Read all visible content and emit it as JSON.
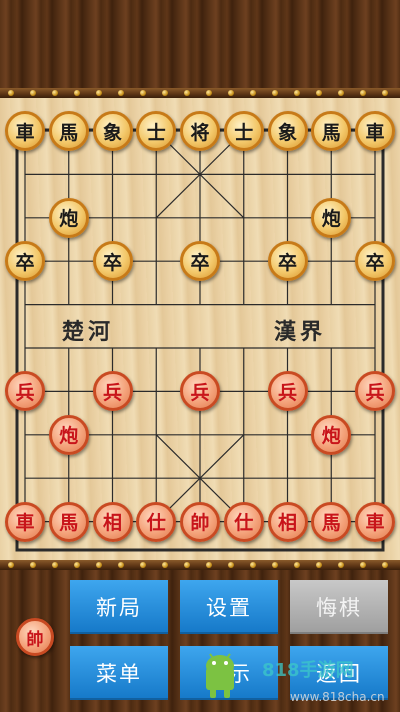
{
  "board": {
    "river_left": "楚河",
    "river_right": "漢界",
    "pieces": [
      {
        "side": "black",
        "label": "車",
        "col": 0,
        "row": 0
      },
      {
        "side": "black",
        "label": "馬",
        "col": 1,
        "row": 0
      },
      {
        "side": "black",
        "label": "象",
        "col": 2,
        "row": 0
      },
      {
        "side": "black",
        "label": "士",
        "col": 3,
        "row": 0
      },
      {
        "side": "black",
        "label": "将",
        "col": 4,
        "row": 0
      },
      {
        "side": "black",
        "label": "士",
        "col": 5,
        "row": 0
      },
      {
        "side": "black",
        "label": "象",
        "col": 6,
        "row": 0
      },
      {
        "side": "black",
        "label": "馬",
        "col": 7,
        "row": 0
      },
      {
        "side": "black",
        "label": "車",
        "col": 8,
        "row": 0
      },
      {
        "side": "black",
        "label": "炮",
        "col": 1,
        "row": 2
      },
      {
        "side": "black",
        "label": "炮",
        "col": 7,
        "row": 2
      },
      {
        "side": "black",
        "label": "卒",
        "col": 0,
        "row": 3
      },
      {
        "side": "black",
        "label": "卒",
        "col": 2,
        "row": 3
      },
      {
        "side": "black",
        "label": "卒",
        "col": 4,
        "row": 3
      },
      {
        "side": "black",
        "label": "卒",
        "col": 6,
        "row": 3
      },
      {
        "side": "black",
        "label": "卒",
        "col": 8,
        "row": 3
      },
      {
        "side": "red",
        "label": "兵",
        "col": 0,
        "row": 6
      },
      {
        "side": "red",
        "label": "兵",
        "col": 2,
        "row": 6
      },
      {
        "side": "red",
        "label": "兵",
        "col": 4,
        "row": 6
      },
      {
        "side": "red",
        "label": "兵",
        "col": 6,
        "row": 6
      },
      {
        "side": "red",
        "label": "兵",
        "col": 8,
        "row": 6
      },
      {
        "side": "red",
        "label": "炮",
        "col": 1,
        "row": 7
      },
      {
        "side": "red",
        "label": "炮",
        "col": 7,
        "row": 7
      },
      {
        "side": "red",
        "label": "車",
        "col": 0,
        "row": 9
      },
      {
        "side": "red",
        "label": "馬",
        "col": 1,
        "row": 9
      },
      {
        "side": "red",
        "label": "相",
        "col": 2,
        "row": 9
      },
      {
        "side": "red",
        "label": "仕",
        "col": 3,
        "row": 9
      },
      {
        "side": "red",
        "label": "帥",
        "col": 4,
        "row": 9
      },
      {
        "side": "red",
        "label": "仕",
        "col": 5,
        "row": 9
      },
      {
        "side": "red",
        "label": "相",
        "col": 6,
        "row": 9
      },
      {
        "side": "red",
        "label": "馬",
        "col": 7,
        "row": 9
      },
      {
        "side": "red",
        "label": "車",
        "col": 8,
        "row": 9
      }
    ]
  },
  "turn_indicator": {
    "side": "red",
    "label": "帥"
  },
  "buttons": {
    "new_game": "新局",
    "settings": "设置",
    "undo": "悔棋",
    "menu": "菜单",
    "hint": "提示",
    "back": "返回"
  },
  "watermark": {
    "text": "818手游网",
    "url": "www.818cha.cn"
  },
  "colors": {
    "button_blue": "#1e88d8",
    "button_disabled": "#b0b0b0",
    "red_piece_text": "#c8141a",
    "black_piece_text": "#1a1a1a"
  }
}
